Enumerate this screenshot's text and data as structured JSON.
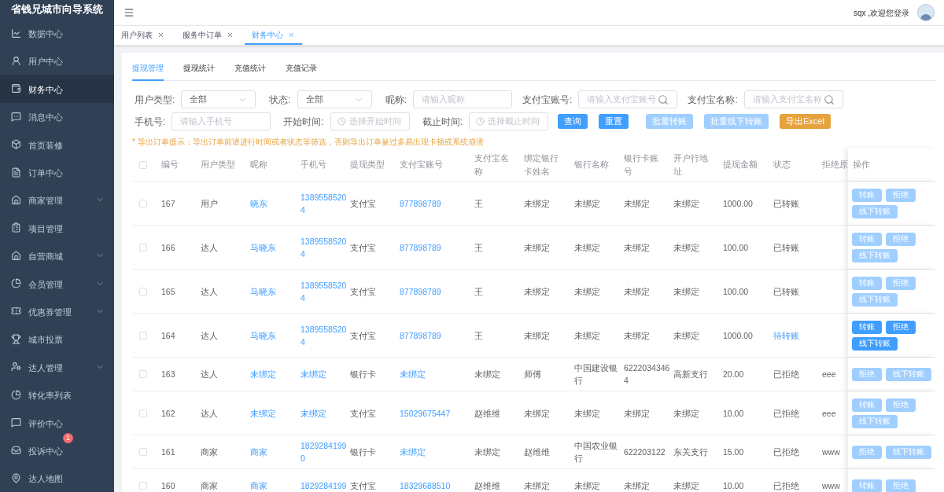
{
  "app_title": "省钱兄城市向导系统",
  "sidebar": {
    "items": [
      {
        "label": "数据中心",
        "selected": false,
        "expandable": false
      },
      {
        "label": "用户中心",
        "selected": false,
        "expandable": false
      },
      {
        "label": "财务中心",
        "selected": true,
        "expandable": false
      },
      {
        "label": "消息中心",
        "selected": false,
        "expandable": false
      },
      {
        "label": "首页装修",
        "selected": false,
        "expandable": false
      },
      {
        "label": "订单中心",
        "selected": false,
        "expandable": false
      },
      {
        "label": "商家管理",
        "selected": false,
        "expandable": true
      },
      {
        "label": "项目管理",
        "selected": false,
        "expandable": false
      },
      {
        "label": "自营商城",
        "selected": false,
        "expandable": true
      },
      {
        "label": "会员管理",
        "selected": false,
        "expandable": true
      },
      {
        "label": "优惠券管理",
        "selected": false,
        "expandable": true
      },
      {
        "label": "城市投票",
        "selected": false,
        "expandable": false
      },
      {
        "label": "达人管理",
        "selected": false,
        "expandable": true
      },
      {
        "label": "转化率列表",
        "selected": false,
        "expandable": false
      },
      {
        "label": "评价中心",
        "selected": false,
        "expandable": false
      },
      {
        "label": "投诉中心",
        "selected": false,
        "expandable": false,
        "badge": "1"
      },
      {
        "label": "达人地图",
        "selected": false,
        "expandable": false
      }
    ]
  },
  "header": {
    "greeting": "sqx ,欢迎您登录"
  },
  "tags": [
    {
      "label": "用户列表",
      "selected": false
    },
    {
      "label": "服务中订单",
      "selected": false
    },
    {
      "label": "财务中心",
      "selected": true
    }
  ],
  "tabs": [
    {
      "label": "提现管理",
      "selected": true
    },
    {
      "label": "提现统计",
      "selected": false
    },
    {
      "label": "充值统计",
      "selected": false
    },
    {
      "label": "充值记录",
      "selected": false
    }
  ],
  "filter_rows": [
    [
      {
        "kind": "select",
        "label": "用户类型:",
        "value": "全部"
      },
      {
        "kind": "select",
        "label": "状态:",
        "value": "全部"
      },
      {
        "kind": "input",
        "label": "昵称:",
        "placeholder": "请输入昵称"
      },
      {
        "kind": "search",
        "label": "支付宝账号:",
        "placeholder": "请输入支付宝账号"
      },
      {
        "kind": "search",
        "label": "支付宝名称:",
        "placeholder": "请输入支付宝名称"
      }
    ],
    [
      {
        "kind": "input",
        "label": "手机号:",
        "placeholder": "请输入手机号"
      },
      {
        "kind": "date",
        "label": "开始时间:",
        "placeholder": "选择开始时间"
      },
      {
        "kind": "date",
        "label": "截止时间:",
        "placeholder": "选择截止时间"
      }
    ]
  ],
  "buttons": [
    {
      "label": "查询",
      "kind": "primary",
      "disabled": false
    },
    {
      "label": "重置",
      "kind": "primary",
      "disabled": false
    },
    {
      "label": "批量转账",
      "kind": "primary",
      "disabled": true
    },
    {
      "label": "批量线下转账",
      "kind": "primary",
      "disabled": true
    },
    {
      "label": "导出Excel",
      "kind": "warning",
      "disabled": false
    }
  ],
  "notice": "* 导出订单提示：导出订单前请进行时间或者状态等筛选，否则导出订单量过多易出现卡顿或系统崩溃",
  "table": {
    "all_checked": false,
    "columns": [
      {
        "label": "编号",
        "kind": "text"
      },
      {
        "label": "用户类型",
        "kind": "text"
      },
      {
        "label": "昵称",
        "kind": "link"
      },
      {
        "label": "手机号",
        "kind": "link"
      },
      {
        "label": "提现类型",
        "kind": "text"
      },
      {
        "label": "支付宝账号",
        "kind": "link"
      },
      {
        "label": "支付宝名称",
        "kind": "text"
      },
      {
        "label": "绑定银行卡姓名",
        "kind": "text"
      },
      {
        "label": "银行名称",
        "kind": "text"
      },
      {
        "label": "银行卡账号",
        "kind": "text"
      },
      {
        "label": "开户行地址",
        "kind": "text"
      },
      {
        "label": "提现金额",
        "kind": "text"
      },
      {
        "label": "状态",
        "kind": "status"
      },
      {
        "label": "拒绝原",
        "kind": "text"
      }
    ],
    "actions_label": "操作",
    "rows": [
      {
        "checked": false,
        "pending": false,
        "cells": [
          "167",
          "用户",
          "晓东",
          "13895585204",
          "支付宝",
          "877898789",
          "王",
          "未绑定",
          "未绑定",
          "未绑定",
          "未绑定",
          "1000.00",
          "已转账"
        ],
        "actions": [
          {
            "label": "转账",
            "disabled": true
          },
          {
            "label": "拒绝",
            "disabled": true
          },
          {
            "label": "线下转账",
            "disabled": true
          }
        ]
      },
      {
        "checked": false,
        "pending": false,
        "cells": [
          "166",
          "达人",
          "马晓东",
          "13895585204",
          "支付宝",
          "877898789",
          "王",
          "未绑定",
          "未绑定",
          "未绑定",
          "未绑定",
          "100.00",
          "已转账"
        ],
        "actions": [
          {
            "label": "转账",
            "disabled": true
          },
          {
            "label": "拒绝",
            "disabled": true
          },
          {
            "label": "线下转账",
            "disabled": true
          }
        ]
      },
      {
        "checked": false,
        "pending": false,
        "cells": [
          "165",
          "达人",
          "马晓东",
          "13895585204",
          "支付宝",
          "877898789",
          "王",
          "未绑定",
          "未绑定",
          "未绑定",
          "未绑定",
          "100.00",
          "已转账"
        ],
        "actions": [
          {
            "label": "转账",
            "disabled": true
          },
          {
            "label": "拒绝",
            "disabled": true
          },
          {
            "label": "线下转账",
            "disabled": true
          }
        ]
      },
      {
        "checked": false,
        "pending": true,
        "cells": [
          "164",
          "达人",
          "马晓东",
          "13895585204",
          "支付宝",
          "877898789",
          "王",
          "未绑定",
          "未绑定",
          "未绑定",
          "未绑定",
          "1000.00",
          "待转账"
        ],
        "actions": [
          {
            "label": "转账",
            "disabled": false
          },
          {
            "label": "拒绝",
            "disabled": false
          },
          {
            "label": "线下转账",
            "disabled": false
          }
        ]
      },
      {
        "checked": false,
        "pending": false,
        "cells": [
          "163",
          "达人",
          "未绑定",
          "未绑定",
          "银行卡",
          "未绑定",
          "未绑定",
          "师傅",
          "中国建设银行",
          "62220343464",
          "高新支行",
          "20.00",
          "已拒绝",
          "eee"
        ],
        "actions": [
          {
            "label": "拒绝",
            "disabled": true
          },
          {
            "label": "线下转账",
            "disabled": true
          }
        ]
      },
      {
        "checked": false,
        "pending": false,
        "cells": [
          "162",
          "达人",
          "未绑定",
          "未绑定",
          "支付宝",
          "15029675447",
          "赵维维",
          "未绑定",
          "未绑定",
          "未绑定",
          "未绑定",
          "10.00",
          "已拒绝",
          "eee"
        ],
        "actions": [
          {
            "label": "转账",
            "disabled": true
          },
          {
            "label": "拒绝",
            "disabled": true
          },
          {
            "label": "线下转账",
            "disabled": true
          }
        ]
      },
      {
        "checked": false,
        "pending": false,
        "cells": [
          "161",
          "商家",
          "商家",
          "18292841990",
          "银行卡",
          "未绑定",
          "未绑定",
          "赵维维",
          "中国农业银行",
          "622203122",
          "东关支行",
          "15.00",
          "已拒绝",
          "www"
        ],
        "actions": [
          {
            "label": "拒绝",
            "disabled": true
          },
          {
            "label": "线下转账",
            "disabled": true
          }
        ]
      },
      {
        "checked": false,
        "pending": false,
        "cells": [
          "160",
          "商家",
          "商家",
          "1829284199",
          "支付宝",
          "18329688510",
          "赵维维",
          "未绑定",
          "未绑定",
          "未绑定",
          "未绑定",
          "10.00",
          "已拒绝",
          "www"
        ],
        "actions": [
          {
            "label": "转账",
            "disabled": true
          },
          {
            "label": "拒绝",
            "disabled": true
          }
        ]
      }
    ]
  }
}
